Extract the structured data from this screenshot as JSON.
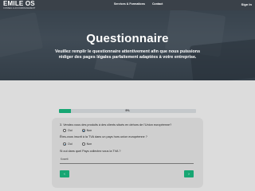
{
  "header": {
    "logo_main": "EMILE OS",
    "logo_sub": "CONSEIL & ACCOMPAGNEMENT",
    "nav": [
      "Services & Formations",
      "Contact"
    ],
    "signin": "Sign In",
    "colors": {
      "bar": "#3a4149",
      "text": "#ffffff"
    }
  },
  "hero": {
    "title": "Questionnaire",
    "subtitle": "Veuillez remplir le questionnaire attentivement afin que nous puissions rédiger des pages légales parfaitement adaptées à votre entreprise."
  },
  "progress": {
    "label": "9%",
    "value": 0.09,
    "color": "#17a673"
  },
  "form": {
    "q1": "3. Vendez-vous des produits à des clients situés en dehors de l'Union européenne?",
    "q1_options": [
      {
        "label": "Oui",
        "checked": false
      },
      {
        "label": "Non",
        "checked": true
      }
    ],
    "q2": "Êtes-vous inscrit à la TVA dans un pays hors union européenne ?",
    "q2_options": [
      {
        "label": "Oui",
        "checked": true
      },
      {
        "label": "Non",
        "checked": false
      }
    ],
    "q3": "Si oui dans quel Pays collectez vous la TVA ?",
    "q3_value": "Koweit",
    "prev_icon": "chevron-left-icon",
    "next_icon": "chevron-right-icon",
    "prev_glyph": "‹",
    "next_glyph": "›"
  }
}
